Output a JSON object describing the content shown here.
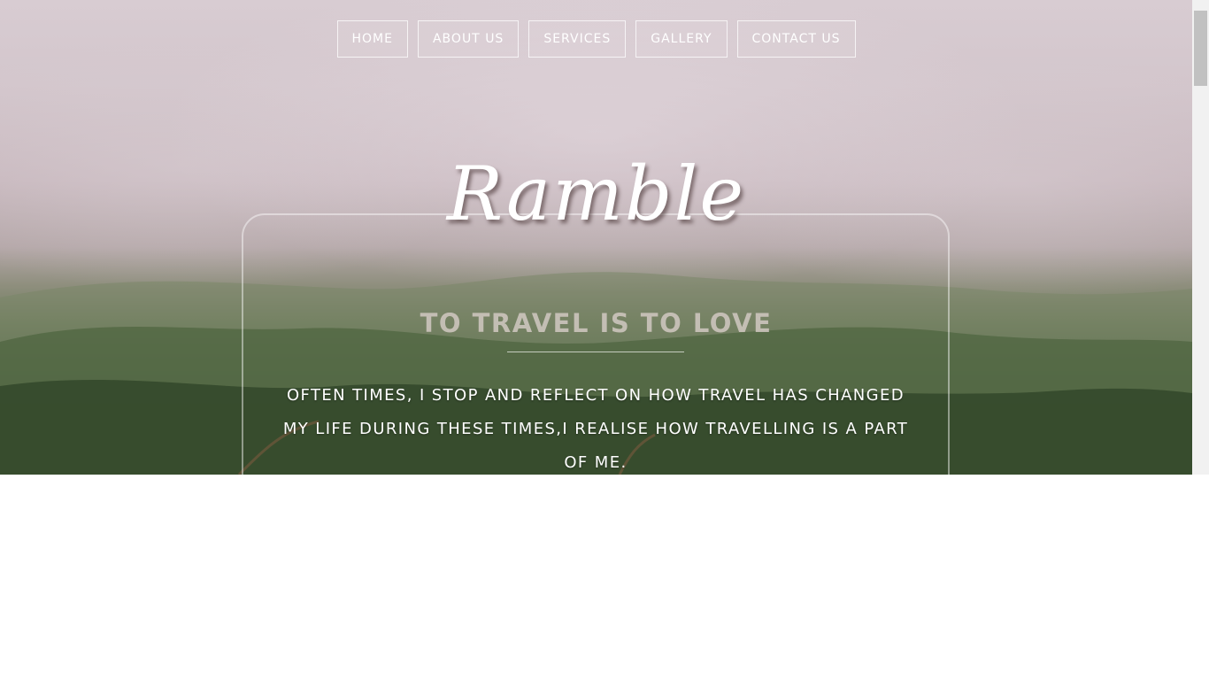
{
  "nav": {
    "items": [
      {
        "label": "HOME"
      },
      {
        "label": "ABOUT US"
      },
      {
        "label": "SERVICES"
      },
      {
        "label": "GALLERY"
      },
      {
        "label": "CONTACT US"
      }
    ]
  },
  "hero": {
    "brand": "Ramble",
    "tagline": "TO TRAVEL IS TO LOVE",
    "intro": "OFTEN TIMES, I STOP AND REFLECT ON HOW TRAVEL HAS CHANGED MY LIFE DURING THESE TIMES,I REALISE HOW TRAVELLING IS A PART OF ME."
  },
  "colors": {
    "nav_border": "#ffffff",
    "text": "#ffffff",
    "page_background": "#ffffff"
  }
}
